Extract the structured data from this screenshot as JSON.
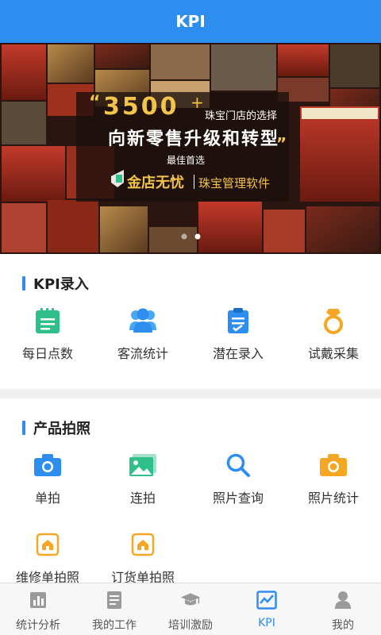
{
  "header": {
    "title": "KPI"
  },
  "banner": {
    "big_number": "3500",
    "plus": "+",
    "subtitle": "珠宝门店的选择",
    "headline": "向新零售升级和转型",
    "tagline": "最佳首选",
    "brand": "金店无忧",
    "product": "珠宝管理软件",
    "dots_total": 2,
    "dots_active": 1
  },
  "kpi_section": {
    "title": "KPI录入",
    "items": [
      {
        "label": "每日点数",
        "icon": "calendar-icon"
      },
      {
        "label": "客流统计",
        "icon": "people-icon"
      },
      {
        "label": "潜在录入",
        "icon": "clipboard-icon"
      },
      {
        "label": "试戴采集",
        "icon": "ring-icon"
      }
    ]
  },
  "photo_section": {
    "title": "产品拍照",
    "items": [
      {
        "label": "单拍",
        "icon": "camera-icon"
      },
      {
        "label": "连拍",
        "icon": "gallery-icon"
      },
      {
        "label": "照片查询",
        "icon": "search-icon"
      },
      {
        "label": "照片统计",
        "icon": "camera-stats-icon"
      },
      {
        "label": "维修单拍照",
        "icon": "repair-photo-icon"
      },
      {
        "label": "订货单拍照",
        "icon": "order-photo-icon"
      }
    ]
  },
  "tabbar": {
    "active": 3,
    "items": [
      {
        "label": "统计分析",
        "icon": "bar-chart-icon"
      },
      {
        "label": "我的工作",
        "icon": "document-icon"
      },
      {
        "label": "培训激励",
        "icon": "graduation-cap-icon"
      },
      {
        "label": "KPI",
        "icon": "line-chart-icon"
      },
      {
        "label": "我的",
        "icon": "user-icon"
      }
    ]
  },
  "colors": {
    "accent": "#2e8ef0",
    "green": "#2fbf8a",
    "orange": "#f5a623",
    "gold_text": "#f3c34a"
  }
}
